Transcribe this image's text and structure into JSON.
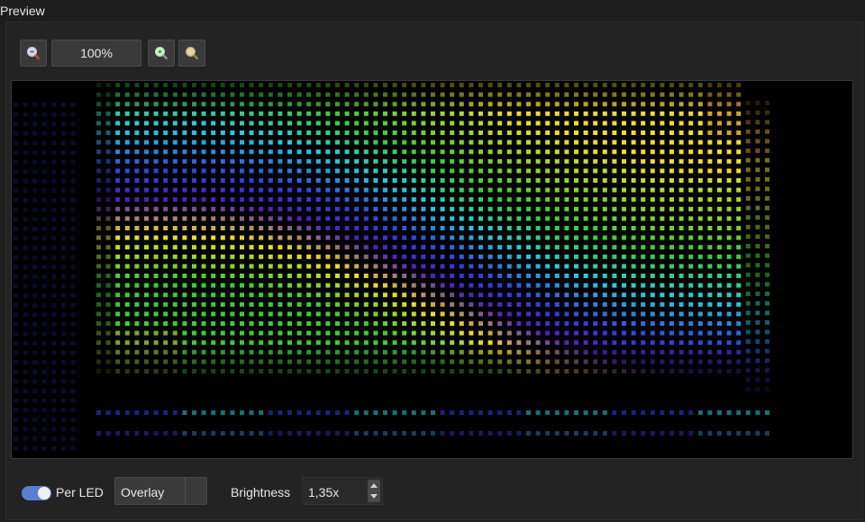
{
  "panel": {
    "title": "Preview"
  },
  "zoom": {
    "value": "100%",
    "zoom_out_icon": "zoom-out-magnifier-icon",
    "zoom_in_icon": "zoom-in-magnifier-icon",
    "zoom_fit_icon": "zoom-fit-magnifier-icon"
  },
  "controls": {
    "per_led_label": "Per LED",
    "per_led_on": true,
    "mode_value": "Overlay",
    "brightness_label": "Brightness",
    "brightness_value": "1,35x"
  },
  "colors": {
    "accent": "#5a7fd0",
    "yellow": "#f0e020",
    "green": "#38d030",
    "cyan": "#20d0e0",
    "blue": "#3040e0",
    "purple": "#5020c0",
    "orange": "#c08020"
  }
}
